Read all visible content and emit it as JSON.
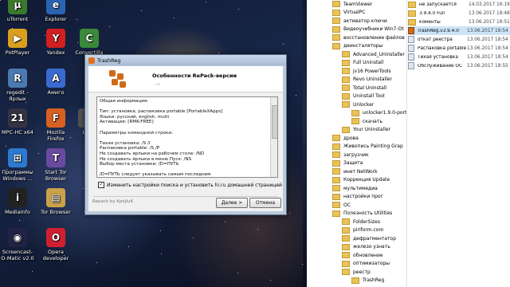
{
  "desktop": {
    "icons": [
      {
        "label": "uTorrent",
        "color": "#3a7a2a",
        "glyph": "µ"
      },
      {
        "label": "Explorer",
        "color": "#2a64b0",
        "glyph": "e"
      },
      {
        "label": "PotPlayer",
        "color": "#d9a020",
        "glyph": "▶"
      },
      {
        "label": "Yandex",
        "color": "#d02020",
        "glyph": "Y"
      },
      {
        "label": "Convertilla",
        "color": "#3a8a3a",
        "glyph": "C"
      },
      {
        "label": "regedit - Ярлык",
        "color": "#4a7ab0",
        "glyph": "R"
      },
      {
        "label": "Амиго",
        "color": "#3a6ad0",
        "glyph": "A"
      },
      {
        "label": "MPC-HC x64",
        "color": "#334",
        "glyph": "21"
      },
      {
        "label": "Mozilla Firefox",
        "color": "#d86020",
        "glyph": "F"
      },
      {
        "label": "Umi",
        "color": "#555",
        "glyph": "U"
      },
      {
        "label": "Программы Windows ...",
        "color": "#2a7ad0",
        "glyph": "⊞"
      },
      {
        "label": "Start Tor Browser",
        "color": "#6a4aa0",
        "glyph": "T"
      },
      {
        "label": "MediaInfo",
        "color": "#222",
        "glyph": "i"
      },
      {
        "label": "Tor Browser",
        "color": "#caa24a",
        "glyph": "▤"
      },
      {
        "label": "Screencast-O-Matic v2.0",
        "color": "#224",
        "glyph": "◉"
      },
      {
        "label": "Opera developer",
        "color": "#d02030",
        "glyph": "O"
      }
    ]
  },
  "dialog": {
    "title": "TrashReg",
    "banner_title": "Особенности RePack-версии",
    "banner_sub": "...",
    "memo_lines": [
      "Общая информация:",
      "",
      "Тип: установка, распаковка portable [PortableXApps]",
      "Языки: русский, english, multi",
      "Активация: [RMK-FREE]",
      "",
      "Параметры командной строки:",
      "",
      "Тихая установка: /S /I",
      "Распаковка portable: /S /P",
      "Не создавать ярлыки на рабочем столе: /ND",
      "Не создавать ярлыки в меню Пуск: /NS",
      "Выбор места установки: /D=ПУТЬ",
      "",
      "/D=ПУТЬ следует указывать самым последним"
    ],
    "checkbox_label": "Изменить настройки поиска и установить hi.ru домашней страницей",
    "checkbox_checked": true,
    "credit": "Repack by KpoJIuK",
    "next_button": "Далее >",
    "cancel_button": "Отмена"
  },
  "explorer": {
    "tree": [
      {
        "label": "TeamViewer",
        "level": 0
      },
      {
        "label": "VirtualPC",
        "level": 0
      },
      {
        "label": "активатор ключи",
        "level": 0
      },
      {
        "label": "Видеоучебники Win7-Ot",
        "level": 0
      },
      {
        "label": "восстановление файлов",
        "level": 0
      },
      {
        "label": "деинсталяторы",
        "level": 0
      },
      {
        "label": "Advanced_Uninstaller",
        "level": 1
      },
      {
        "label": "Full Uninstall",
        "level": 1
      },
      {
        "label": "jv16 PowerTools",
        "level": 1
      },
      {
        "label": "Revo Uninstaller",
        "level": 1
      },
      {
        "label": "Total Uninstall",
        "level": 1
      },
      {
        "label": "Uninstall Tool",
        "level": 1
      },
      {
        "label": "Unlocker",
        "level": 1
      },
      {
        "label": "unlocker1.9.0-portabl",
        "level": 2
      },
      {
        "label": "скачать",
        "level": 2
      },
      {
        "label": "Your Uninstaller",
        "level": 1
      },
      {
        "label": "дрова",
        "level": 0
      },
      {
        "label": "Живопись Painting Grap",
        "level": 0
      },
      {
        "label": "загрузчик",
        "level": 0
      },
      {
        "label": "Защита",
        "level": 0
      },
      {
        "label": "инет NetWork",
        "level": 0
      },
      {
        "label": "Коррекция Update",
        "level": 0
      },
      {
        "label": "мультимедиа",
        "level": 0
      },
      {
        "label": "настройки прог",
        "level": 0
      },
      {
        "label": "ОС",
        "level": 0
      },
      {
        "label": "Полезность Utilities",
        "level": 0
      },
      {
        "label": "FolderSizes",
        "level": 1
      },
      {
        "label": "piriform.com",
        "level": 1
      },
      {
        "label": "дефрагментатор",
        "level": 1
      },
      {
        "label": "железо узнать",
        "level": 1
      },
      {
        "label": "обновление",
        "level": 1
      },
      {
        "label": "оптимизаторы",
        "level": 1
      },
      {
        "label": "реестр",
        "level": 1
      },
      {
        "label": "TrashReg",
        "level": 2
      }
    ],
    "files": [
      {
        "name": "не запускается",
        "date": "14.03.2017 16:19",
        "type": "folder",
        "selected": false
      },
      {
        "name": "3.9.4.0 Full",
        "date": "13.06.2017 18:48",
        "type": "folder",
        "selected": false
      },
      {
        "name": "коменты",
        "date": "13.06.2017 18:51",
        "type": "folder",
        "selected": false
      },
      {
        "name": "TrashReg.v3.9.4.0",
        "date": "13.06.2017 18:54",
        "type": "exe",
        "selected": true
      },
      {
        "name": "откат реестра",
        "date": "13.06.2017 18:54",
        "type": "file",
        "selected": false
      },
      {
        "name": "Распаковка portable",
        "date": "13.06.2017 18:54",
        "type": "file",
        "selected": false
      },
      {
        "name": "Тихая установка",
        "date": "13.06.2017 18:54",
        "type": "file",
        "selected": false
      },
      {
        "name": "Обслуживание ОС",
        "date": "13.06.2017 18:55",
        "type": "file",
        "selected": false
      }
    ]
  }
}
